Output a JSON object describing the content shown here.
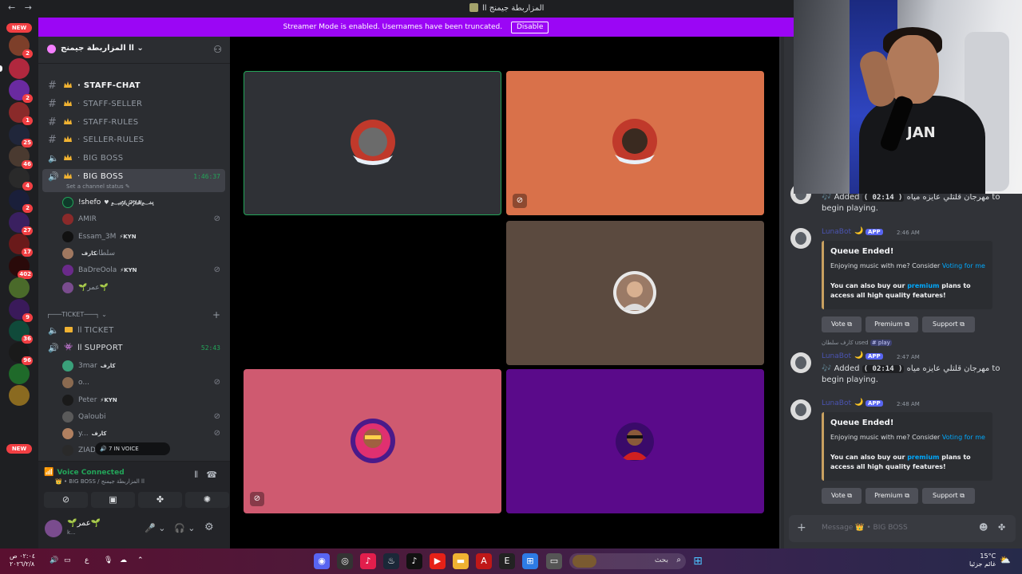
{
  "titlebar": {
    "nav": "← →",
    "title": "المزاربطة جيمنج اا"
  },
  "banner": {
    "text": "Streamer Mode is enabled. Usernames have been truncated.",
    "button": "Disable"
  },
  "rail": {
    "new_label": "NEW",
    "badges": [
      "2",
      "2",
      "1",
      "25",
      "46",
      "4",
      "2",
      "27",
      "17",
      "402",
      "9",
      "36",
      "96"
    ]
  },
  "guild": {
    "name": "اا المزاربطة جيمنج"
  },
  "channels": [
    {
      "label": "STAFF-CHAT"
    },
    {
      "label": "STAFF-SELLER"
    },
    {
      "label": "STAFF-RULES"
    },
    {
      "label": "SELLER-RULES"
    },
    {
      "label": "BIG BOSS"
    },
    {
      "label": "BIG BOSS",
      "timer": "1:46:37",
      "status": "Set a channel status"
    }
  ],
  "voice_users_bigboss": [
    {
      "name": "!shefo",
      "tag": "♥ ﷽"
    },
    {
      "name": "AMIR"
    },
    {
      "name": "Essam_3M",
      "tag": "⚡KYN"
    },
    {
      "name": "سلطان",
      "tag": "كارف"
    },
    {
      "name": "BaDreOola",
      "tag": "⚡KYN"
    },
    {
      "name": "عمر"
    }
  ],
  "ticket_category": "┌───TICKET───┐",
  "ticket_channel": "TICKET",
  "support": {
    "label": "SUPPORT",
    "timer": "52:43"
  },
  "voice_users_support": [
    {
      "name": "3mar",
      "tag": "كارف"
    },
    {
      "name": "o..."
    },
    {
      "name": "Peter",
      "tag": "⚡KYN"
    },
    {
      "name": "Qaloubi"
    },
    {
      "name": "y...",
      "tag": "كارف"
    },
    {
      "name": "ZIAD"
    }
  ],
  "voice_pill": {
    "text": "7 IN VOICE"
  },
  "voice_panel": {
    "state": "Voice Connected",
    "sub": "BIG BOSS / اا المزاربطة جيمنج"
  },
  "user_panel": {
    "name": "عمر",
    "tag": "k..."
  },
  "chat": {
    "messages": [
      {
        "pre": "🎶 Added",
        "code": "( 02:14 )",
        "song": "مهرجان قلتلي عايزه مياه",
        "post": "to begin playing."
      },
      {
        "author": "LunaBot",
        "app": "APP",
        "time": "2:46 AM"
      },
      {
        "author": "LunaBot",
        "app": "APP",
        "time": "2:47 AM",
        "pre": "🎶 Added",
        "code": "( 02:14 )",
        "song": "مهرجان قلتلي عايزه مياه",
        "post": "to begin playing."
      },
      {
        "author": "LunaBot",
        "app": "APP",
        "time": "2:48 AM"
      }
    ],
    "embed": {
      "title": "Queue Ended!",
      "desc_pre": "Enjoying music with me? Consider",
      "desc_link": "Voting for me",
      "extra_pre": "You can also buy our",
      "extra_link": "premium",
      "extra_post": "plans to access all high quality features!"
    },
    "buttons": [
      "Vote",
      "Premium",
      "Support"
    ],
    "reply": {
      "user": "كارف سلطان",
      "used": "used",
      "cmd": "# play"
    },
    "input_placeholder": "Message 👑 • BIG BOSS"
  },
  "webcam": {
    "shirt_text": "JAN"
  },
  "taskbar": {
    "time": "٠٢:٠٤ ص",
    "date": "٢٠٢٦/٢/٨",
    "lang": "ع",
    "search": "بحث",
    "temp": "15°C",
    "weather": "غائم جزئيا"
  },
  "colors": {
    "accent": "#5865f2",
    "online": "#23a559",
    "banner": "#9b06f5",
    "tile_orange": "#d9714a",
    "tile_brown": "#5b4a3f",
    "tile_pink": "#cf5a70",
    "tile_purple": "#5a0a8a"
  }
}
